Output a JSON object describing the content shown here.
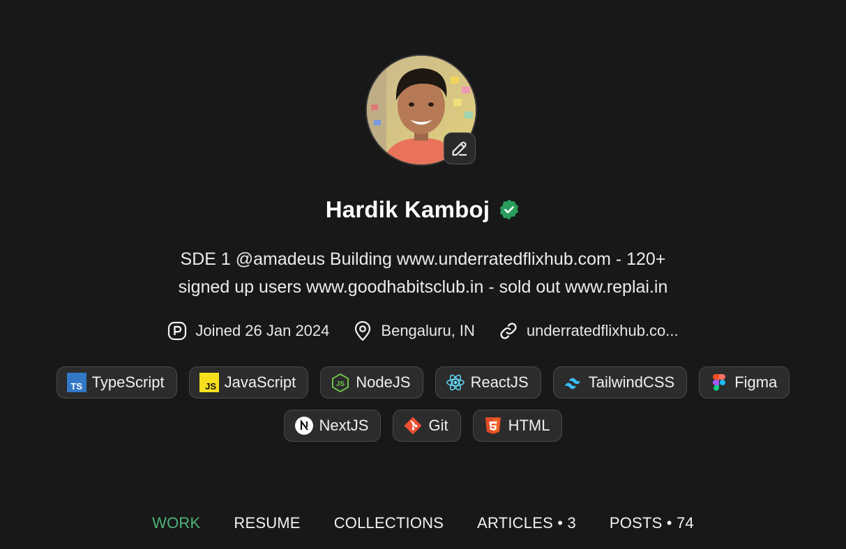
{
  "profile": {
    "name": "Hardik Kamboj",
    "bio_line1": "SDE 1 @amadeus Building www.underratedflixhub.com - 120+",
    "bio_line2": "signed up users www.goodhabitsclub.in - sold out www.replai.in",
    "joined": "Joined 26 Jan 2024",
    "location": "Bengaluru, IN",
    "website": "underratedflixhub.co..."
  },
  "icons": {
    "verified": "verified-badge-icon",
    "edit": "pencil-icon",
    "joined": "peerlist-p-icon",
    "location": "map-pin-icon",
    "website": "link-icon"
  },
  "skills": [
    {
      "label": "TypeScript",
      "icon": "typescript-icon"
    },
    {
      "label": "JavaScript",
      "icon": "javascript-icon"
    },
    {
      "label": "NodeJS",
      "icon": "nodejs-icon"
    },
    {
      "label": "ReactJS",
      "icon": "react-icon"
    },
    {
      "label": "TailwindCSS",
      "icon": "tailwind-icon"
    },
    {
      "label": "Figma",
      "icon": "figma-icon"
    },
    {
      "label": "NextJS",
      "icon": "nextjs-icon"
    },
    {
      "label": "Git",
      "icon": "git-icon"
    },
    {
      "label": "HTML",
      "icon": "html5-icon"
    }
  ],
  "tabs": [
    {
      "label": "WORK",
      "active": true
    },
    {
      "label": "RESUME"
    },
    {
      "label": "COLLECTIONS"
    },
    {
      "label": "ARTICLES • 3"
    },
    {
      "label": "POSTS • 74"
    }
  ],
  "colors": {
    "background": "#181818",
    "accent": "#4fb37a",
    "verified": "#2a9d5c",
    "chip_bg": "#2c2c2c"
  }
}
